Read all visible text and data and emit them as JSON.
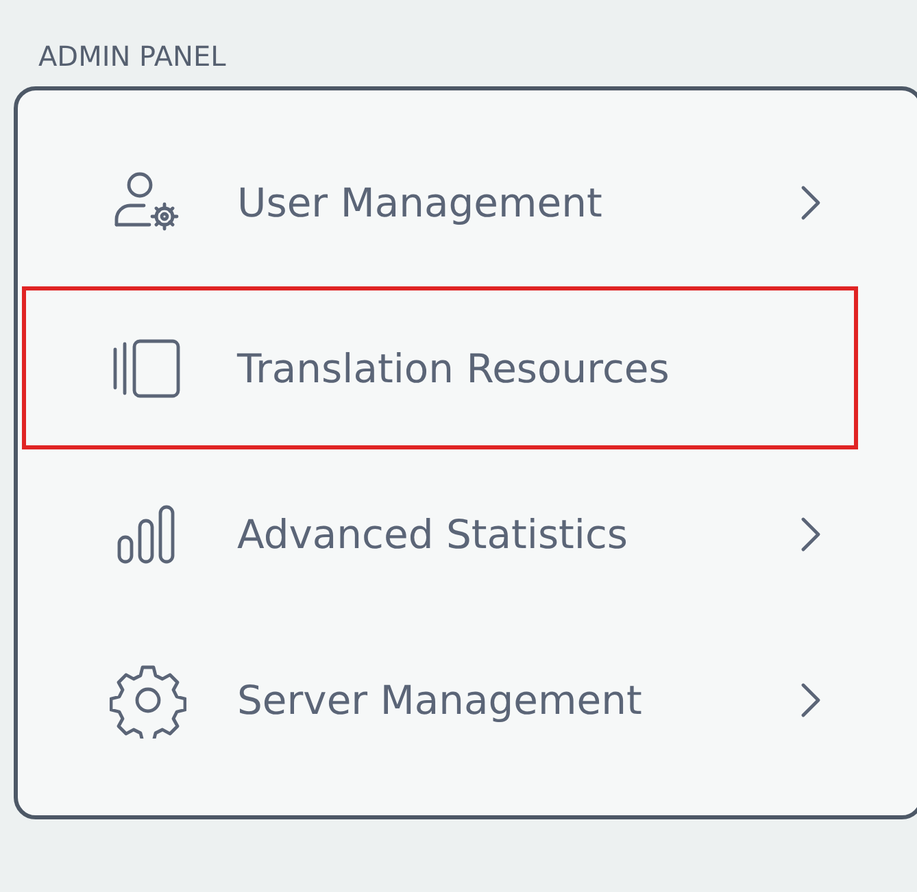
{
  "section_label": "ADMIN PANEL",
  "items": [
    {
      "label": "User Management",
      "chevron": true,
      "selected": false
    },
    {
      "label": "Translation Resources",
      "chevron": false,
      "selected": true
    },
    {
      "label": "Advanced Statistics",
      "chevron": true,
      "selected": false
    },
    {
      "label": "Server Management",
      "chevron": true,
      "selected": false
    }
  ]
}
